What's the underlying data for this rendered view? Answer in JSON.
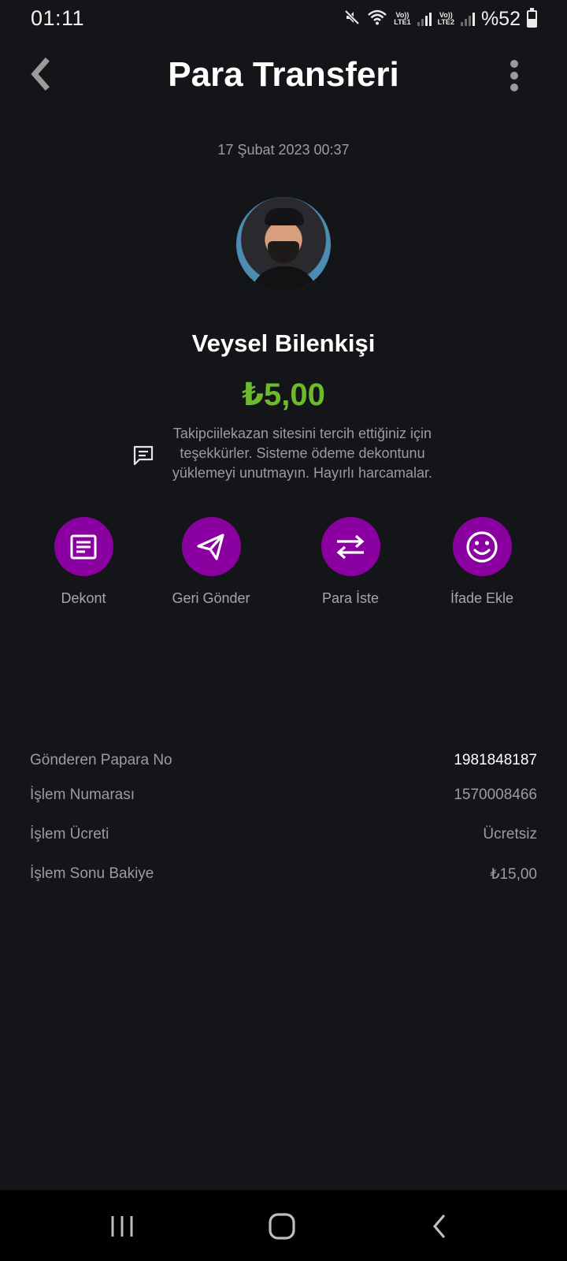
{
  "status_bar": {
    "time": "01:11",
    "lte1": "LTE1",
    "lte2": "LTE2",
    "volte": "Vo))",
    "battery_text": "%52",
    "battery_level": 0.52,
    "icons": [
      "mute-icon",
      "wifi-icon",
      "signal-icon",
      "battery-icon"
    ]
  },
  "header": {
    "title": "Para Transferi",
    "back_icon": "chevron-left-icon",
    "more_icon": "more-vertical-icon"
  },
  "transaction": {
    "timestamp": "17 Şubat 2023 00:37",
    "recipient_name": "Veysel Bilenkişi",
    "amount": "₺5,00",
    "note": "Takipciilekazan sitesini tercih ettiğiniz için teşekkürler. Sisteme ödeme dekontunu yüklemeyi unutmayın. Hayırlı harcamalar."
  },
  "actions": [
    {
      "label": "Dekont",
      "icon": "receipt-icon"
    },
    {
      "label": "Geri Gönder",
      "icon": "send-icon"
    },
    {
      "label": "Para İste",
      "icon": "swap-icon"
    },
    {
      "label": "İfade Ekle",
      "icon": "smiley-icon"
    }
  ],
  "details": [
    {
      "label": "Gönderen Papara No",
      "value": "1981848187"
    },
    {
      "label": "İşlem Numarası",
      "value": "1570008466"
    },
    {
      "label": "İşlem Ücreti",
      "value": "Ücretsiz"
    },
    {
      "label": "İşlem Sonu Bakiye",
      "value": "₺15,00"
    }
  ],
  "colors": {
    "background": "#141519",
    "accent": "#8b00a1",
    "amount": "#6dbb2c",
    "muted_text": "#9b9ba2"
  }
}
